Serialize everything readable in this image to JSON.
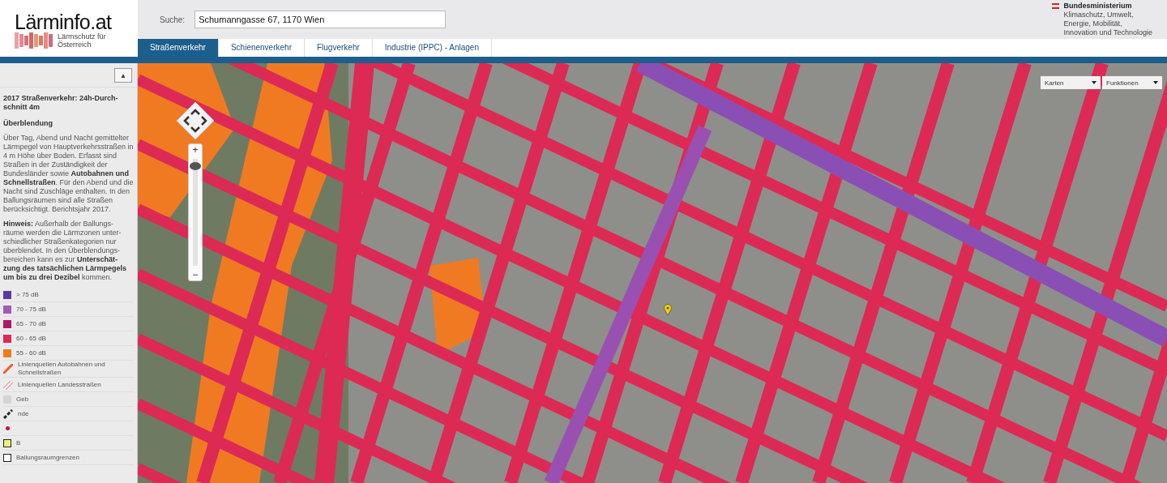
{
  "logo": {
    "title": "Lärminfo.at",
    "subtitle": "Lärmschutz für Österreich"
  },
  "search": {
    "label": "Suche:",
    "value": "Schumanngasse 67, 1170 Wien"
  },
  "ministry": {
    "name": "Bundesministerium",
    "lines": [
      "Klimaschutz, Umwelt,",
      "Energie, Mobilität,",
      "Innovation und Technologie"
    ]
  },
  "tabs": [
    {
      "label": "Straßenverkehr",
      "selected": true
    },
    {
      "label": "Schienenverkehr",
      "selected": false
    },
    {
      "label": "Flugverkehr",
      "selected": false
    },
    {
      "label": "Industrie (IPPC) - Anlagen",
      "selected": false
    }
  ],
  "sidebar": {
    "collapse_button": "▲",
    "title": "2017 Straßenverkehr: 24h-Durch-schnitt 4m",
    "subtitle": "Überblendung",
    "paragraphs": [
      "Über Tag, Abend und Nacht gemittelter Lärmpegel von Hauptverkehrsstraßen in 4 m Höhe über Boden. Erfasst sind Straßen in der Zuständigkeit der Bundesländer sowie **Autobahnen und Schnellstraßen**. Für den Abend und die Nacht sind Zuschläge enthalten. In den Ballungsräumen sind alle Straßen berücksichtigt. Berichtsjahr 2017.",
      "**Hinweis:** Außerhalb der Ballungs-räume werden die Lärmzonen unter-schiedlicher Straßenkategorien nur überblendet. In den Überblendungs-bereichen kann es zur **Unterschät-zung des tatsächlichen Lärmpegels um bis zu drei Dezibel** kommen."
    ],
    "legend": [
      {
        "kind": "swatch",
        "label": "> 75 dB",
        "color": "#5b3aa0"
      },
      {
        "kind": "swatch",
        "label": "70 - 75 dB",
        "color": "#a35bb8"
      },
      {
        "kind": "swatch",
        "label": "65 - 70 dB",
        "color": "#b0186a"
      },
      {
        "kind": "swatch",
        "label": "60 - 65 dB",
        "color": "#dc2a55"
      },
      {
        "kind": "swatch",
        "label": "55 - 60 dB",
        "color": "#f07a22"
      },
      {
        "kind": "line",
        "label": "Linienquellen Autobahnen und Schnellstraßen",
        "color": "#f05a28"
      },
      {
        "kind": "hatch",
        "label": "Linienquellen Landesstraßen",
        "color": "#e07a8a"
      },
      {
        "kind": "swatch",
        "label": "Geb",
        "color": "#d4d4d4"
      },
      {
        "kind": "dash",
        "label": "nde",
        "color": "#222222"
      },
      {
        "kind": "dot",
        "color": "#c0143c"
      },
      {
        "kind": "outline",
        "label": "B",
        "color": "#f0f080"
      },
      {
        "kind": "outline",
        "label": "Ballungsraumgrenzen",
        "color": "#ffffff"
      }
    ]
  },
  "map": {
    "zoom": {
      "plus": "+",
      "minus": "−",
      "level": 0.93
    },
    "menus": [
      {
        "label": "Karten"
      },
      {
        "label": "Funktionen"
      }
    ]
  }
}
